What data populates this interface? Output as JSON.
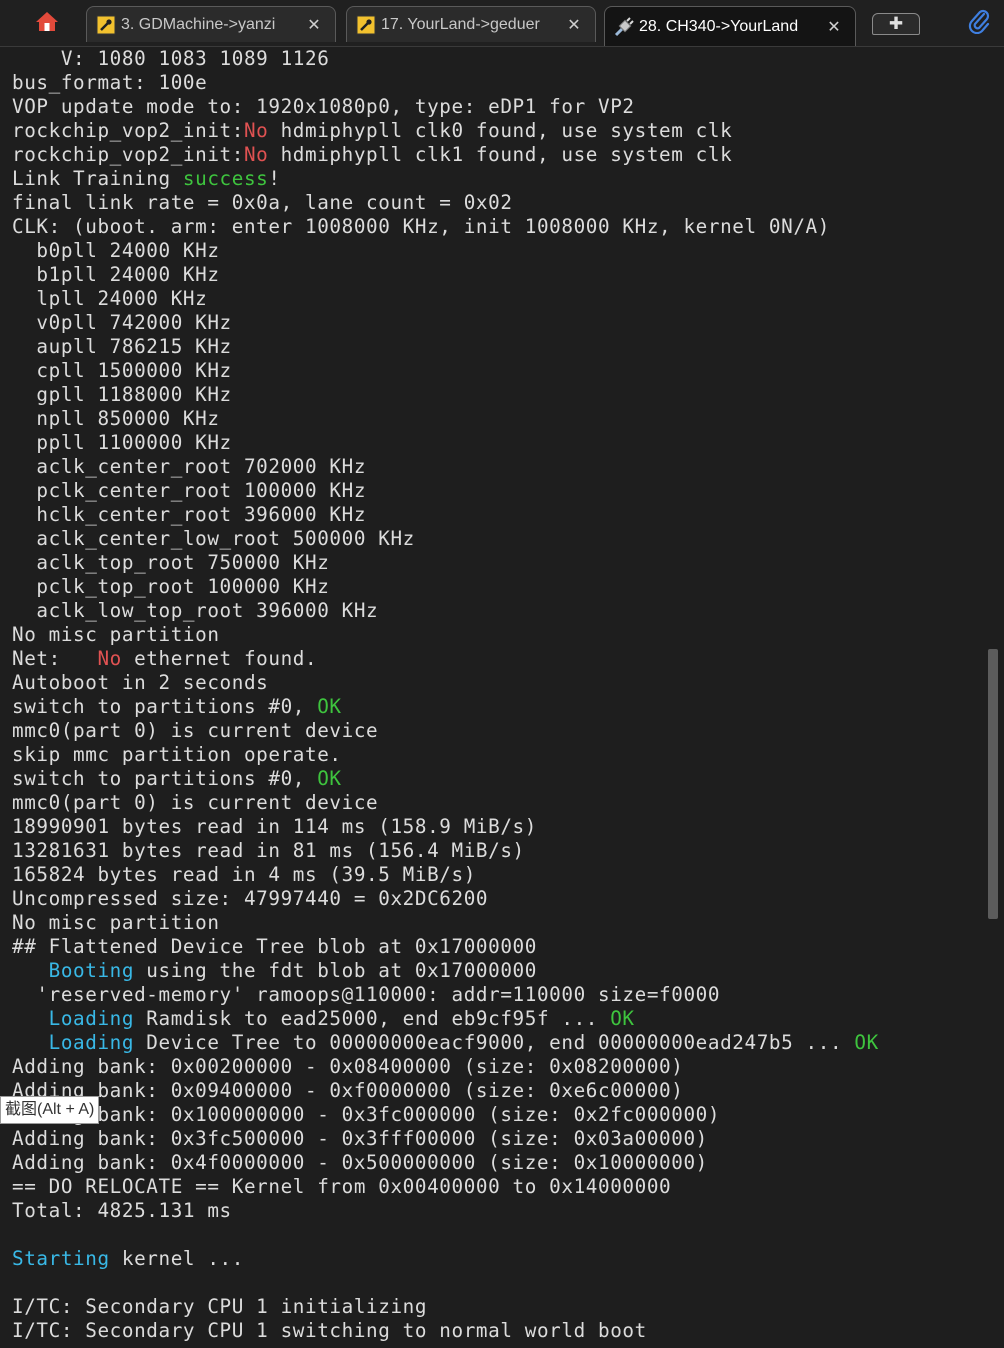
{
  "tabs": [
    {
      "label": "3. GDMachine->yanzi",
      "icon": "wrench-icon",
      "active": false
    },
    {
      "label": "17. YourLand->geduer",
      "icon": "wrench-icon",
      "active": false
    },
    {
      "label": "28. CH340->YourLand",
      "icon": "serial-plug-icon",
      "active": true
    }
  ],
  "tab_close_glyph": "✕",
  "new_tab_glyph": "✚",
  "tooltip": "截图(Alt + A)",
  "colors": {
    "background": "#1e1e1e",
    "text": "#dcdcdc",
    "red": "#e05252",
    "green": "#3ec43e",
    "cyan": "#39b8e6"
  },
  "terminal": {
    "lines": [
      [
        {
          "t": "    V: 1080 1083 1089 1126"
        }
      ],
      [
        {
          "t": "bus_format: 100e"
        }
      ],
      [
        {
          "t": "VOP update mode to: 1920x1080p0, type: eDP1 for VP2"
        }
      ],
      [
        {
          "t": "rockchip_vop2_init:"
        },
        {
          "t": "No",
          "c": "red"
        },
        {
          "t": " hdmiphypll clk0 found, use system clk"
        }
      ],
      [
        {
          "t": "rockchip_vop2_init:"
        },
        {
          "t": "No",
          "c": "red"
        },
        {
          "t": " hdmiphypll clk1 found, use system clk"
        }
      ],
      [
        {
          "t": "Link Training "
        },
        {
          "t": "success",
          "c": "green"
        },
        {
          "t": "!"
        }
      ],
      [
        {
          "t": "final link rate = 0x0a, lane count = 0x02"
        }
      ],
      [
        {
          "t": "CLK: (uboot. arm: enter 1008000 KHz, init 1008000 KHz, kernel 0N/A)"
        }
      ],
      [
        {
          "t": "  b0pll 24000 KHz"
        }
      ],
      [
        {
          "t": "  b1pll 24000 KHz"
        }
      ],
      [
        {
          "t": "  lpll 24000 KHz"
        }
      ],
      [
        {
          "t": "  v0pll 742000 KHz"
        }
      ],
      [
        {
          "t": "  aupll 786215 KHz"
        }
      ],
      [
        {
          "t": "  cpll 1500000 KHz"
        }
      ],
      [
        {
          "t": "  gpll 1188000 KHz"
        }
      ],
      [
        {
          "t": "  npll 850000 KHz"
        }
      ],
      [
        {
          "t": "  ppll 1100000 KHz"
        }
      ],
      [
        {
          "t": "  aclk_center_root 702000 KHz"
        }
      ],
      [
        {
          "t": "  pclk_center_root 100000 KHz"
        }
      ],
      [
        {
          "t": "  hclk_center_root 396000 KHz"
        }
      ],
      [
        {
          "t": "  aclk_center_low_root 500000 KHz"
        }
      ],
      [
        {
          "t": "  aclk_top_root 750000 KHz"
        }
      ],
      [
        {
          "t": "  pclk_top_root 100000 KHz"
        }
      ],
      [
        {
          "t": "  aclk_low_top_root 396000 KHz"
        }
      ],
      [
        {
          "t": "No misc partition"
        }
      ],
      [
        {
          "t": "Net:   "
        },
        {
          "t": "No",
          "c": "red"
        },
        {
          "t": " ethernet found."
        }
      ],
      [
        {
          "t": "Autoboot in 2 seconds"
        }
      ],
      [
        {
          "t": "switch to partitions #0, "
        },
        {
          "t": "OK",
          "c": "green"
        }
      ],
      [
        {
          "t": "mmc0(part 0) is current device"
        }
      ],
      [
        {
          "t": "skip mmc partition operate."
        }
      ],
      [
        {
          "t": "switch to partitions #0, "
        },
        {
          "t": "OK",
          "c": "green"
        }
      ],
      [
        {
          "t": "mmc0(part 0) is current device"
        }
      ],
      [
        {
          "t": "18990901 bytes read in 114 ms (158.9 MiB/s)"
        }
      ],
      [
        {
          "t": "13281631 bytes read in 81 ms (156.4 MiB/s)"
        }
      ],
      [
        {
          "t": "165824 bytes read in 4 ms (39.5 MiB/s)"
        }
      ],
      [
        {
          "t": "Uncompressed size: 47997440 = 0x2DC6200"
        }
      ],
      [
        {
          "t": "No misc partition"
        }
      ],
      [
        {
          "t": "## Flattened Device Tree blob at 0x17000000"
        }
      ],
      [
        {
          "t": "   "
        },
        {
          "t": "Booting",
          "c": "cyan"
        },
        {
          "t": " using the fdt blob at 0x17000000"
        }
      ],
      [
        {
          "t": "  'reserved-memory' ramoops@110000: addr=110000 size=f0000"
        }
      ],
      [
        {
          "t": "   "
        },
        {
          "t": "Loading",
          "c": "cyan"
        },
        {
          "t": " Ramdisk to ead25000, end eb9cf95f ... "
        },
        {
          "t": "OK",
          "c": "green"
        }
      ],
      [
        {
          "t": "   "
        },
        {
          "t": "Loading",
          "c": "cyan"
        },
        {
          "t": " Device Tree to 00000000eacf9000, end 00000000ead247b5 ... "
        },
        {
          "t": "OK",
          "c": "green"
        }
      ],
      [
        {
          "t": "Adding bank: 0x00200000 - 0x08400000 (size: 0x08200000)"
        }
      ],
      [
        {
          "t": "Adding bank: 0x09400000 - 0xf0000000 (size: 0xe6c00000)"
        }
      ],
      [
        {
          "t": "Adding bank: 0x100000000 - 0x3fc000000 (size: 0x2fc000000)"
        }
      ],
      [
        {
          "t": "Adding bank: 0x3fc500000 - 0x3fff00000 (size: 0x03a00000)"
        }
      ],
      [
        {
          "t": "Adding bank: 0x4f0000000 - 0x500000000 (size: 0x10000000)"
        }
      ],
      [
        {
          "t": "== DO RELOCATE == Kernel from 0x00400000 to 0x14000000"
        }
      ],
      [
        {
          "t": "Total: 4825.131 ms"
        }
      ],
      [
        {
          "t": ""
        }
      ],
      [
        {
          "t": "Starting",
          "c": "cyan"
        },
        {
          "t": " kernel ..."
        }
      ],
      [
        {
          "t": ""
        }
      ],
      [
        {
          "t": "I/TC: Secondary CPU 1 initializing"
        }
      ],
      [
        {
          "t": "I/TC: Secondary CPU 1 switching to normal world boot"
        }
      ]
    ]
  }
}
